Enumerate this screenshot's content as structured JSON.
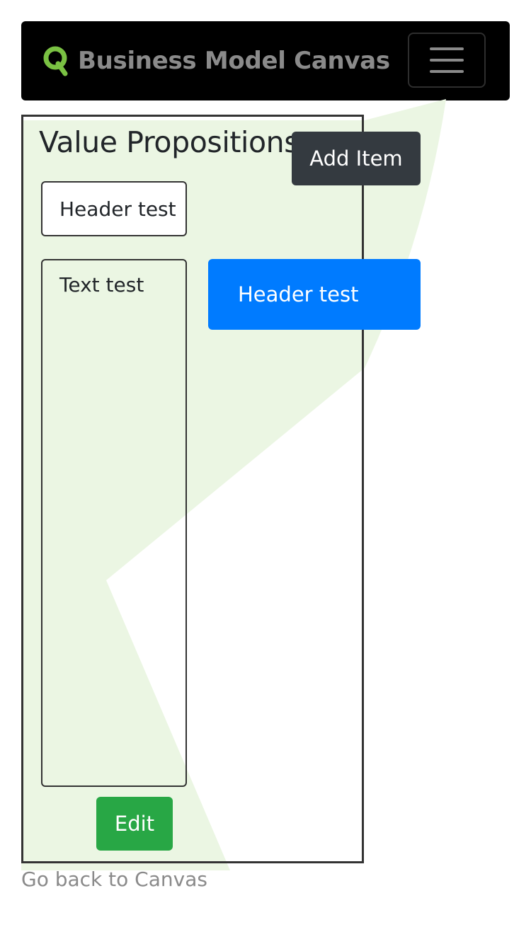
{
  "navbar": {
    "brand_title": "Business Model Canvas",
    "logo_icon": "q-logo-icon",
    "menu_icon": "hamburger-menu-icon",
    "logo_color": "#7ac143"
  },
  "panel": {
    "title": "Value Propositions",
    "header_field_value": "Header test",
    "text_field_value": "Text test",
    "edit_label": "Edit"
  },
  "actions": {
    "add_item_label": "Add Item"
  },
  "items": [
    {
      "header": "Header test"
    }
  ],
  "footer": {
    "back_link_label": "Go back to Canvas"
  },
  "colors": {
    "navbar_bg": "#000000",
    "edit_button": "#28a745",
    "add_item_button": "#343a40",
    "item_card": "#007bff",
    "background_art": "#ebf6e3"
  }
}
